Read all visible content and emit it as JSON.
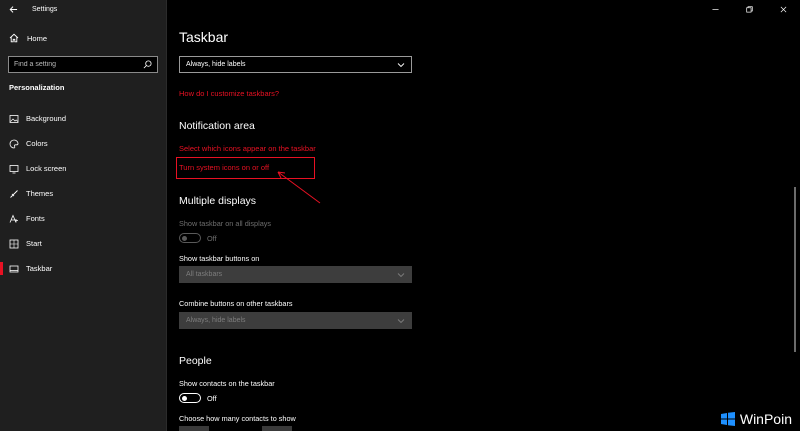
{
  "window": {
    "app_title": "Settings"
  },
  "sidebar": {
    "home_label": "Home",
    "search_placeholder": "Find a setting",
    "section_title": "Personalization",
    "items": [
      {
        "label": "Background",
        "icon": "picture-icon"
      },
      {
        "label": "Colors",
        "icon": "palette-icon"
      },
      {
        "label": "Lock screen",
        "icon": "lock-screen-icon"
      },
      {
        "label": "Themes",
        "icon": "themes-icon"
      },
      {
        "label": "Fonts",
        "icon": "fonts-icon"
      },
      {
        "label": "Start",
        "icon": "start-icon"
      },
      {
        "label": "Taskbar",
        "icon": "taskbar-icon",
        "active": true
      }
    ]
  },
  "main": {
    "title": "Taskbar",
    "combine_dropdown_value": "Always, hide labels",
    "customize_link": "How do I customize taskbars?",
    "notification_area": {
      "heading": "Notification area",
      "link_select_icons": "Select which icons appear on the taskbar",
      "link_system_icons": "Turn system icons on or off"
    },
    "multiple_displays": {
      "heading": "Multiple displays",
      "show_on_all_label": "Show taskbar on all displays",
      "show_on_all_state": "Off",
      "buttons_on_label": "Show taskbar buttons on",
      "buttons_on_value": "All taskbars",
      "combine_other_label": "Combine buttons on other taskbars",
      "combine_other_value": "Always, hide labels"
    },
    "people": {
      "heading": "People",
      "show_contacts_label": "Show contacts on the taskbar",
      "show_contacts_state": "Off",
      "how_many_label": "Choose how many contacts to show"
    }
  },
  "watermark": {
    "text": "WinPoin"
  },
  "colors": {
    "accent": "#e81123",
    "sidebar_bg": "#1f1f1f",
    "main_bg": "#000000"
  }
}
